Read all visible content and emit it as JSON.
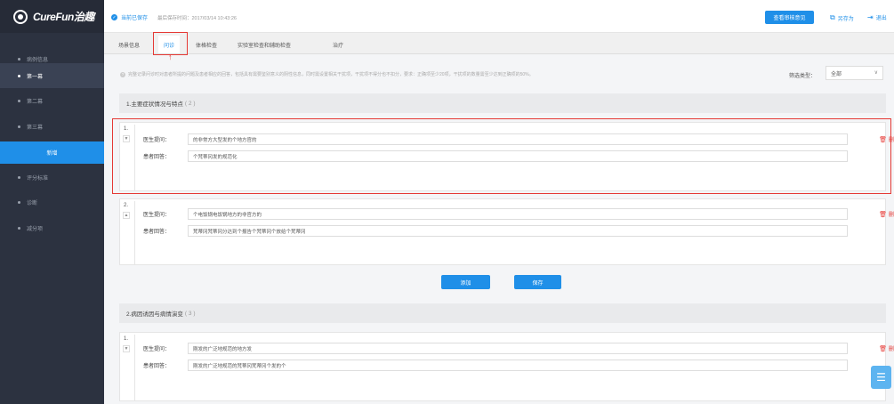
{
  "logo": {
    "text": "CureFun治趣"
  },
  "sidebar": {
    "items": [
      {
        "label": "病例信息"
      },
      {
        "label": "第一幕"
      },
      {
        "label": "第二幕"
      },
      {
        "label": "第三幕"
      },
      {
        "label": "新增"
      },
      {
        "label": "评分标准"
      },
      {
        "label": "诊断"
      },
      {
        "label": "减分项"
      }
    ]
  },
  "topbar": {
    "saved_status": "当前已保存",
    "save_time": "最后保存时间：2017/03/14 10:43:26",
    "review_button": "查看审核意见",
    "save_as": "另存为",
    "logout": "退出"
  },
  "tabs": [
    {
      "label": "场景信息"
    },
    {
      "label": "问诊"
    },
    {
      "label": "体格检查"
    },
    {
      "label": "实验室检查和辅助检查"
    },
    {
      "label": "治疗"
    }
  ],
  "notice": "完整记录问诊时对患者所提的问题及患者相应的回答，包括具有需要鉴别意义的阴性信息，同时需设置相关干扰项，干扰项不得分也不扣分，要求：正确项至少20项，干扰项的数量需至少达到正确项的50%。",
  "filter": {
    "label": "筛选类型：",
    "value": "全部"
  },
  "sections": [
    {
      "title": "1.主要症状情况与特点",
      "count": "( 2 )",
      "items": [
        {
          "num": "1.",
          "doctor_label": "医生提问：",
          "doctor_text": "的非常方大型发的个地方官的",
          "patient_label": "患者回答：",
          "patient_text": "个梵蒂冈发的规范化",
          "delete": "删除"
        },
        {
          "num": "2.",
          "doctor_label": "医生提问：",
          "doctor_text": "个电饭锅电饭锅地方的非官方的",
          "patient_label": "患者回答：",
          "patient_text": "梵蒂冈梵蒂冈分达到个报告个梵蒂冈个放给个梵蒂冈",
          "delete": "删除"
        }
      ]
    },
    {
      "title": "2.病因诱因与病情演变",
      "count": "( 3 )",
      "items": [
        {
          "num": "1.",
          "doctor_label": "医生提问：",
          "doctor_text": "刚发的广泛地规范的地方发",
          "patient_label": "患者回答：",
          "patient_text": "刚发的广泛地规范的梵蒂冈梵蒂冈个发的个",
          "delete": "删除"
        }
      ]
    }
  ],
  "actions": {
    "add": "添加",
    "save": "保存"
  },
  "colors": {
    "primary": "#1f8fe8",
    "sidebar": "#2c3240",
    "danger": "#e53935"
  }
}
